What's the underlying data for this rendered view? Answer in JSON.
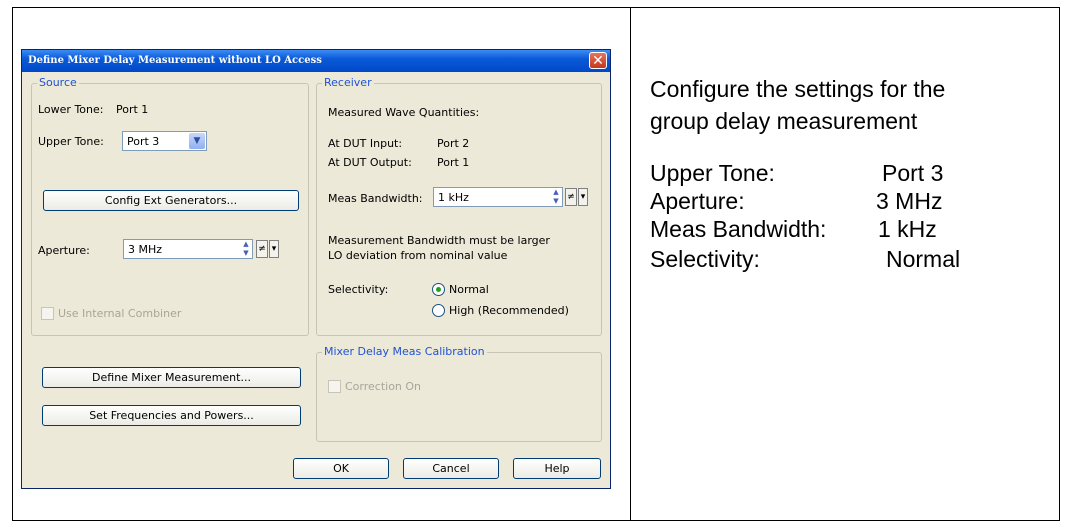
{
  "dialog": {
    "title": "Define Mixer Delay Measurement without LO Access",
    "close_glyph": "✕",
    "source": {
      "legend": "Source",
      "lower_tone_label": "Lower Tone:",
      "lower_tone_value": "Port 1",
      "upper_tone_label": "Upper Tone:",
      "upper_tone_value": "Port 3",
      "config_button": "Config Ext Generators...",
      "aperture_label": "Aperture:",
      "aperture_value": "3 MHz",
      "internal_combiner_label": "Use Internal Combiner",
      "internal_combiner_checked": false
    },
    "receiver": {
      "legend": "Receiver",
      "measured_label": "Measured Wave Quantities:",
      "dut_input_label": "At DUT Input:",
      "dut_input_value": "Port 2",
      "dut_output_label": "At DUT Output:",
      "dut_output_value": "Port 1",
      "meas_bw_label": "Meas Bandwidth:",
      "meas_bw_value": "1 kHz",
      "note_line1": "Measurement Bandwidth must be larger",
      "note_line2": "LO deviation from nominal value",
      "selectivity_label": "Selectivity:",
      "selectivity_options": [
        "Normal",
        "High (Recommended)"
      ],
      "selectivity_selected": "Normal"
    },
    "calibration": {
      "legend": "Mixer Delay Meas Calibration",
      "correction_label": "Correction On",
      "correction_checked": false
    },
    "buttons": {
      "define_mixer": "Define Mixer Measurement...",
      "set_freq": "Set Frequencies and Powers...",
      "ok": "OK",
      "cancel": "Cancel",
      "help": "Help"
    },
    "unit_glyph": "≠",
    "drop_glyph": "▾",
    "combo_arrow_glyph": "▼",
    "spin_up_glyph": "▲",
    "spin_down_glyph": "▼"
  },
  "side_panel": {
    "intro_line1": "Configure the settings for the",
    "intro_line2": "group delay measurement",
    "settings": [
      {
        "label": "Upper Tone:",
        "value": "Port 3"
      },
      {
        "label": "Aperture:",
        "value": "3 MHz"
      },
      {
        "label": "Meas Bandwidth:",
        "value": "1 kHz"
      },
      {
        "label": "Selectivity:",
        "value": "Normal"
      }
    ]
  },
  "colors": {
    "titlebar": "#0a5ad8",
    "dialog_bg": "#ece9d8",
    "legend_text": "#1f52d3",
    "radio_selected": "#21a121"
  }
}
